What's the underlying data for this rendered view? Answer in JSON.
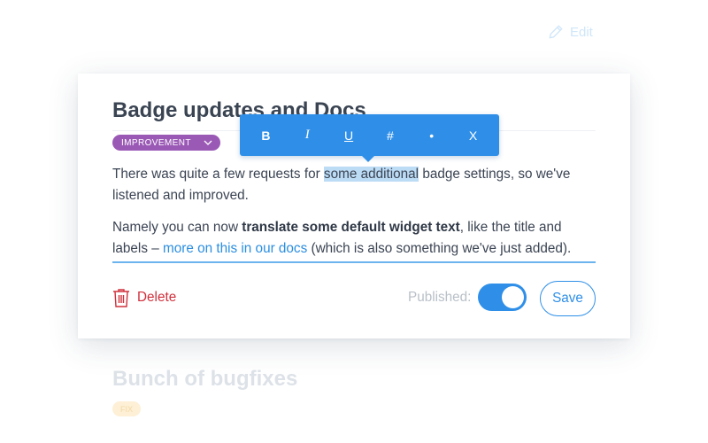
{
  "header": {
    "edit_label": "Edit"
  },
  "entry": {
    "title": "Badge updates and Docs",
    "tag_label": "IMPROVEMENT",
    "paragraph1": {
      "before": "There was quite a few requests for ",
      "selected": "some additional",
      "after": " badge settings, so we've listened and improved."
    },
    "paragraph2": {
      "before": "Namely you can now ",
      "bold": "translate some default widget text",
      "middle": ", like the title and labels – ",
      "link": "more on this in our docs",
      "after": " (which is also something we've just added)."
    }
  },
  "toolbar": {
    "bold": "B",
    "italic": "I",
    "underline": "U",
    "heading": "#",
    "bullet": "•",
    "close": "X"
  },
  "footer": {
    "delete_label": "Delete",
    "published_label": "Published:",
    "published_on": true,
    "save_label": "Save"
  },
  "next_entry": {
    "title": "Bunch of bugfixes",
    "tag_label": "FIX"
  },
  "colors": {
    "accent": "#2f8fe8",
    "improvement_tag": "#9b59b6",
    "delete": "#d0303c",
    "selection": "#bcdcf5"
  }
}
